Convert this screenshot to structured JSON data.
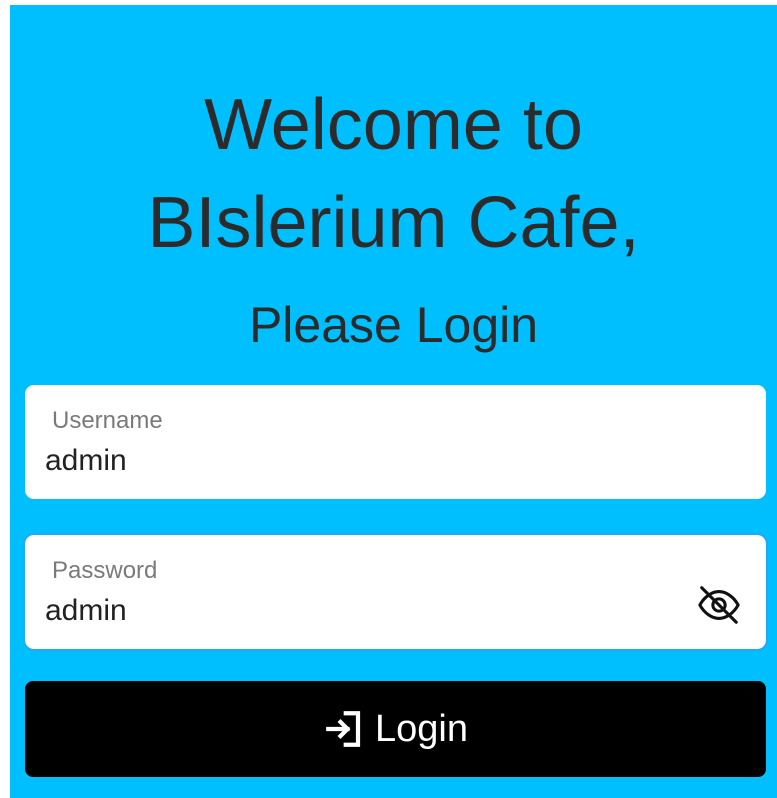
{
  "heading": {
    "line1": "Welcome to",
    "line2": "BIslerium Cafe,",
    "subtitle": "Please Login"
  },
  "username": {
    "label": "Username",
    "value": "admin"
  },
  "password": {
    "label": "Password",
    "value": "admin",
    "toggle_icon": "eye-off-icon"
  },
  "login": {
    "label": "Login",
    "icon": "login-icon"
  },
  "colors": {
    "background": "#00bfff",
    "button": "#000000",
    "heading_text": "#2b2b2b"
  }
}
